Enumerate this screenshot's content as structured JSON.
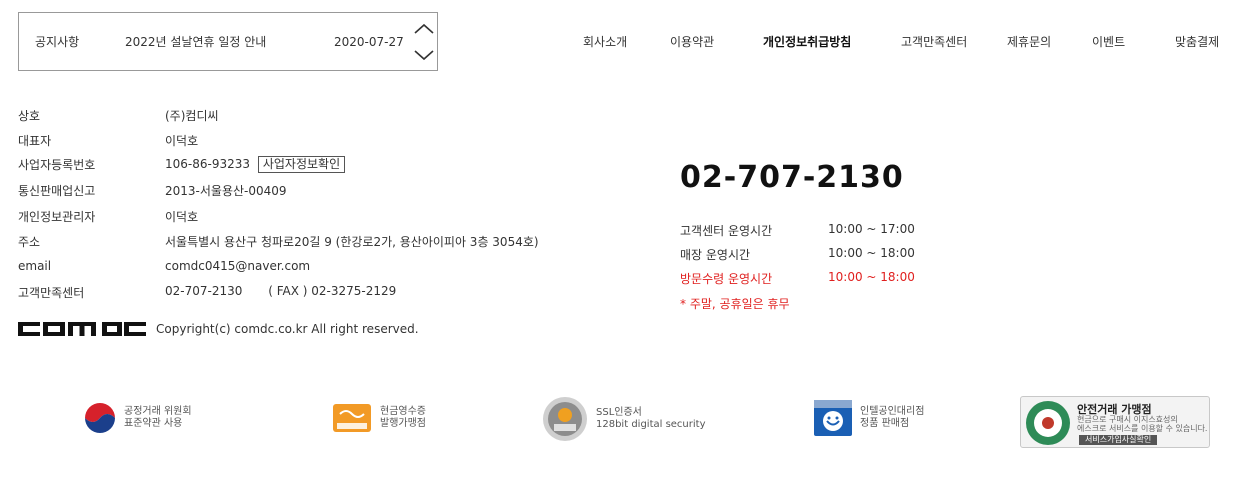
{
  "notice": {
    "label": "공지사항",
    "title": "2022년 설날연휴 일정 안내",
    "date": "2020-07-27"
  },
  "nav": {
    "items": [
      {
        "label": "회사소개"
      },
      {
        "label": "이용약관"
      },
      {
        "label": "개인정보취급방침"
      },
      {
        "label": "고객만족센터"
      },
      {
        "label": "제휴문의"
      },
      {
        "label": "이벤트"
      },
      {
        "label": "맞춤결제"
      }
    ]
  },
  "company": {
    "rows": [
      {
        "key": "상호",
        "value": "(주)컴디씨"
      },
      {
        "key": "대표자",
        "value": "이덕호"
      },
      {
        "key": "사업자등록번호",
        "value": "106-86-93233"
      },
      {
        "key": "통신판매업신고",
        "value": "2013-서울용산-00409"
      },
      {
        "key": "개인정보관리자",
        "value": "이덕호"
      },
      {
        "key": "주소",
        "value": "서울특별시 용산구 청파로20길 9 (한강로2가, 용산아이피아 3층 3054호)"
      },
      {
        "key": "email",
        "value": "comdc0415@naver.com"
      },
      {
        "key": "고객만족센터",
        "value": "02-707-2130"
      }
    ],
    "biz_check_label": "사업자정보확인",
    "fax": "( FAX ) 02-3275-2129",
    "copyright": "Copyright(c) comdc.co.kr All right reserved."
  },
  "callcenter": {
    "phone": "02-707-2130",
    "hours": [
      {
        "label": "고객센터 운영시간",
        "value": "10:00 ~ 17:00"
      },
      {
        "label": "매장 운영시간",
        "value": "10:00 ~ 18:00"
      },
      {
        "label": "방문수령 운영시간",
        "value": "10:00 ~ 18:00"
      }
    ],
    "note": "* 주말, 공휴일은 휴무"
  },
  "badges": [
    {
      "line1": "공정거래 위원회",
      "line2": "표준약관 사용"
    },
    {
      "line1": "현금영수증",
      "line2": "발행가맹점"
    },
    {
      "line1": "SSL인증서",
      "line2": "128bit digital security"
    },
    {
      "line1": "인텔공인대리점",
      "line2": "정품 판매점"
    }
  ],
  "safe": {
    "title": "안전거래 가맹점",
    "desc1": "현금으로 구매시 이지스효성의",
    "desc2": "에스크로 서비스를 이용할 수 있습니다.",
    "button": "서비스가입사실확인"
  },
  "colors": {
    "accent_red": "#e0201f",
    "text": "#333333"
  }
}
